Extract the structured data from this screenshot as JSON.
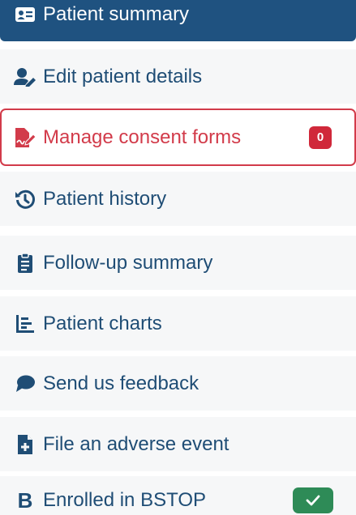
{
  "menu": {
    "items": [
      {
        "label": "Patient summary",
        "icon": "id-card-icon"
      },
      {
        "label": "Edit patient details",
        "icon": "user-edit-icon"
      },
      {
        "label": "Manage consent forms",
        "icon": "file-signature-icon",
        "badge": "0"
      },
      {
        "label": "Patient history",
        "icon": "history-icon"
      },
      {
        "label": "Follow-up summary",
        "icon": "clipboard-list-icon"
      },
      {
        "label": "Patient charts",
        "icon": "chart-bar-icon"
      },
      {
        "label": "Send us feedback",
        "icon": "comment-icon"
      },
      {
        "label": "File an adverse event",
        "icon": "file-plus-icon"
      },
      {
        "label": "Enrolled in BSTOP",
        "icon": "letter-b-icon",
        "icon_text": "B",
        "status": "check-icon"
      }
    ]
  },
  "colors": {
    "primary": "#1f5280",
    "text": "#1f4d75",
    "danger": "#d23b4a",
    "success": "#2e8b57",
    "item_bg": "#f6f7f8"
  }
}
